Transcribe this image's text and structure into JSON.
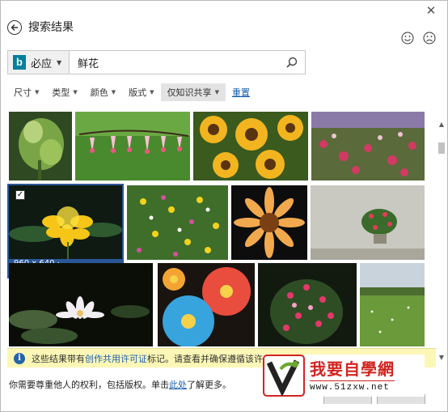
{
  "dialog": {
    "title": "搜索结果",
    "close_glyph": "✕"
  },
  "feedback": {
    "happy_icon": "smile-icon",
    "sad_icon": "frown-icon"
  },
  "search": {
    "engine_label": "必应",
    "engine_logo_letter": "b",
    "query": "鲜花"
  },
  "filters": {
    "items": [
      {
        "label": "尺寸"
      },
      {
        "label": "类型"
      },
      {
        "label": "颜色"
      },
      {
        "label": "版式"
      },
      {
        "label": "仅知识共享"
      }
    ],
    "reset_label": "重置"
  },
  "selected_image": {
    "caption": "960 x 640 · cdn.pixaba..."
  },
  "info_bar": {
    "text_before": "这些结果带有",
    "link": "创作共用许可证",
    "text_after": "标记。请查看并确保遵循该许可"
  },
  "footer": {
    "text_before": "你需要尊重他人的权利，包括版权。单击",
    "link": "此处",
    "text_after": "了解更多。"
  },
  "watermark": {
    "cn_text": "我要自學網",
    "url": "www.51zxw.net"
  },
  "colors": {
    "caption_bar": "#2b5797",
    "info_bar": "#fcf7b6",
    "link": "#1a5fb4",
    "bing": "#00809d"
  }
}
